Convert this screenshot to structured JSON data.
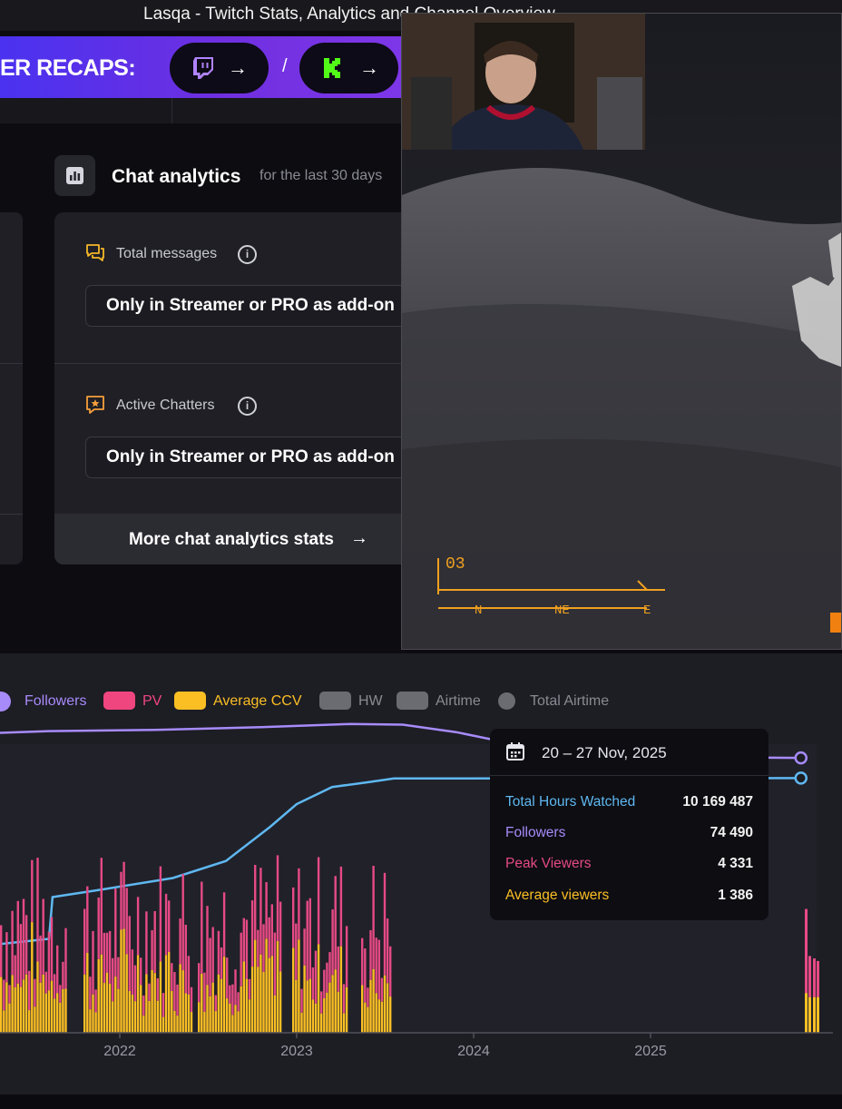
{
  "window": {
    "title": "Lasqa - Twitch Stats, Analytics and Channel Overview"
  },
  "banner": {
    "label": "ER RECAPS:",
    "separator": "/",
    "arrow": "→"
  },
  "chat_analytics": {
    "title": "Chat analytics",
    "subtitle": "for the last 30 days",
    "total_messages": {
      "label": "Total messages",
      "locked_text": "Only in Streamer or PRO as add-on"
    },
    "active_chatters": {
      "label": "Active Chatters",
      "locked_text": "Only in Streamer or PRO as add-on"
    },
    "more_link": "More chat analytics stats",
    "info_glyph": "i"
  },
  "legend": [
    {
      "label": "Followers",
      "color": "#a78bfa",
      "text_color": "#a78bfa"
    },
    {
      "label": "PV",
      "color": "#f0467f",
      "text_color": "#f0467f"
    },
    {
      "label": "Average CCV",
      "color": "#fbbf24",
      "text_color": "#fbbf24"
    },
    {
      "label": "HW",
      "color": "#6b6b72",
      "text_color": "#8a8a92"
    },
    {
      "label": "Airtime",
      "color": "#6b6b72",
      "text_color": "#8a8a92"
    },
    {
      "label": "Total Airtime",
      "color": "#6b6b72",
      "text_color": "#8a8a92"
    }
  ],
  "tooltip": {
    "date": "20 – 27 Nov, 2025",
    "rows": [
      {
        "label": "Total Hours Watched",
        "value": "10 169 487",
        "color": "#5fb8f0"
      },
      {
        "label": "Followers",
        "value": "74 490",
        "color": "#a78bfa"
      },
      {
        "label": "Peak Viewers",
        "value": "4 331",
        "color": "#e64a85"
      },
      {
        "label": "Average viewers",
        "value": "1 386",
        "color": "#fbbf24"
      }
    ]
  },
  "hud": {
    "ammo": "03",
    "compass": [
      "N",
      "NE",
      "E"
    ]
  },
  "chart_data": {
    "type": "bar",
    "x_ticks": [
      "2022",
      "2023",
      "2024",
      "2025"
    ],
    "series": [
      {
        "name": "Total Hours Watched",
        "type": "line",
        "color": "#5fb8f0",
        "points": [
          [
            2021.2,
            1300000
          ],
          [
            2021.6,
            1700000
          ],
          [
            2021.62,
            3900000
          ],
          [
            2021.9,
            4300000
          ],
          [
            2022.3,
            4900000
          ],
          [
            2022.6,
            5800000
          ],
          [
            2022.85,
            7600000
          ],
          [
            2023.0,
            8800000
          ],
          [
            2023.2,
            9700000
          ],
          [
            2023.4,
            9950000
          ],
          [
            2023.55,
            10150000
          ],
          [
            2025.85,
            10169487
          ]
        ]
      },
      {
        "name": "Followers",
        "type": "line",
        "color": "#a78bfa",
        "points": [
          [
            2021.2,
            82000
          ],
          [
            2021.6,
            82800
          ],
          [
            2022.2,
            83200
          ],
          [
            2022.8,
            84000
          ],
          [
            2023.3,
            85000
          ],
          [
            2023.6,
            84800
          ],
          [
            2023.9,
            82500
          ],
          [
            2024.3,
            78000
          ],
          [
            2024.8,
            75000
          ],
          [
            2025.3,
            74700
          ],
          [
            2025.85,
            74490
          ]
        ]
      },
      {
        "name": "PV",
        "type": "bar",
        "color": "#e64a85",
        "note": "weekly peak viewers stacked above average CCV",
        "values": [
          4331
        ]
      },
      {
        "name": "Average CCV",
        "type": "bar",
        "color": "#fbbf24",
        "values": [
          1386
        ]
      }
    ],
    "hover": {
      "date": "20 – 27 Nov, 2025",
      "Total Hours Watched": 10169487,
      "Followers": 74490,
      "Peak Viewers": 4331,
      "Average viewers": 1386
    }
  }
}
